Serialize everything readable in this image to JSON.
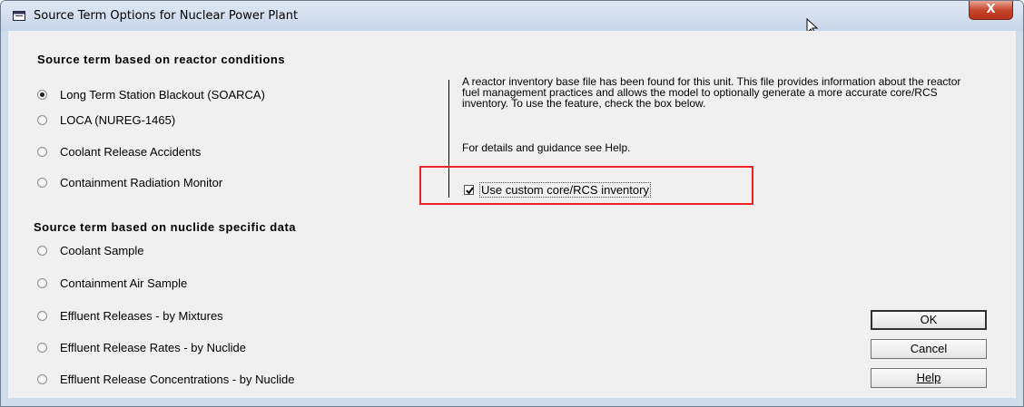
{
  "window": {
    "title": "Source Term Options for Nuclear Power Plant",
    "close_label": "X"
  },
  "section_reactor": {
    "heading": "Source term based on reactor conditions",
    "options": [
      {
        "label": "Long Term Station Blackout (SOARCA)",
        "checked": true
      },
      {
        "label": "LOCA (NUREG-1465)",
        "checked": false
      },
      {
        "label": "Coolant Release Accidents",
        "checked": false
      },
      {
        "label": "Containment Radiation Monitor",
        "checked": false
      }
    ]
  },
  "info": {
    "paragraph": "A reactor inventory base file has been found for this unit. This file provides information about the reactor fuel management practices and allows the model to optionally generate a more accurate core/RCS inventory. To use the feature, check the box below.",
    "help": "For details and guidance see Help.",
    "checkbox_label": "Use custom core/RCS inventory",
    "checkbox_checked": true
  },
  "section_nuclide": {
    "heading": "Source term based on nuclide specific data",
    "options": [
      {
        "label": "Coolant Sample",
        "checked": false
      },
      {
        "label": "Containment Air Sample",
        "checked": false
      },
      {
        "label": "Effluent Releases - by Mixtures",
        "checked": false
      },
      {
        "label": "Effluent Release Rates - by Nuclide",
        "checked": false
      },
      {
        "label": "Effluent Release Concentrations - by Nuclide",
        "checked": false
      }
    ]
  },
  "buttons": {
    "ok": "OK",
    "cancel": "Cancel",
    "help": "Help"
  }
}
